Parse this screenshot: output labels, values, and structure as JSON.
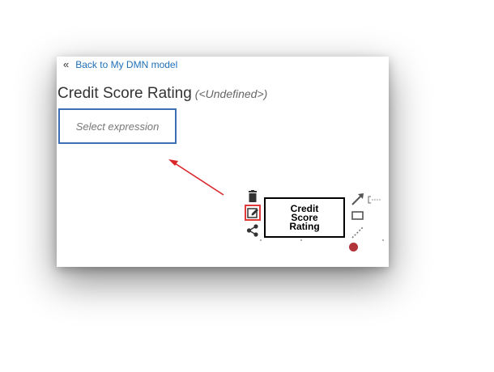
{
  "nav": {
    "back_arrow": "«",
    "back_label": "Back to My DMN model"
  },
  "header": {
    "title": "Credit Score Rating",
    "type_label": "(<Undefined>)"
  },
  "expression": {
    "placeholder": "Select expression"
  },
  "decision_node": {
    "label": "Credit Score Rating"
  },
  "palette_icons": {
    "delete": "trash-icon",
    "edit": "edit-icon",
    "share": "share-icon",
    "connect": "arrow-connector-icon",
    "annotation": "text-annotation-icon",
    "box": "rectangle-icon",
    "association": "dotted-line-icon",
    "end": "red-dot-icon"
  },
  "colors": {
    "link": "#1f6fb6",
    "selection_border": "#3a6fb3",
    "highlight_red": "#e13a3a",
    "annotation_arrow": "#d9262b"
  }
}
